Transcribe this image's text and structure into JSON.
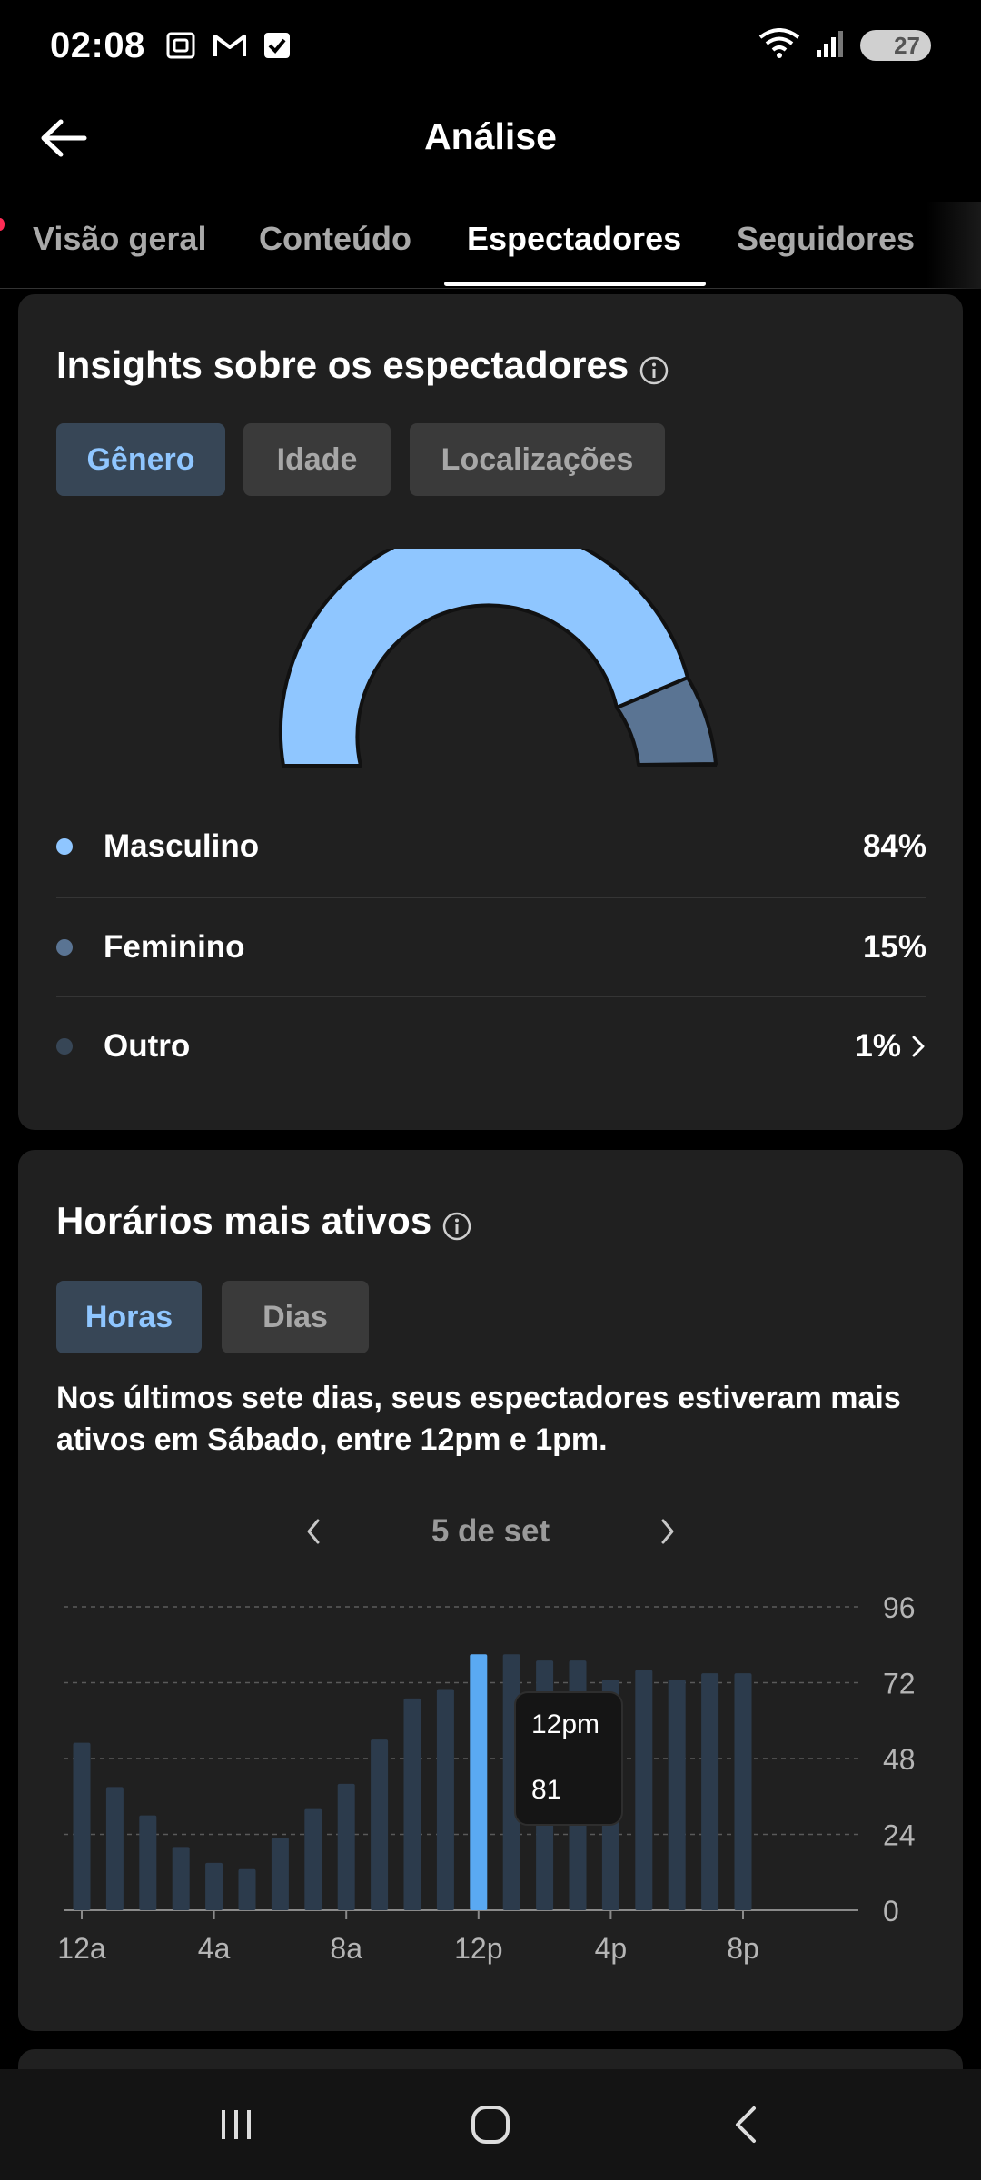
{
  "status_bar": {
    "time": "02:08",
    "battery": "27",
    "icons_left": [
      "screenshot-icon",
      "gmail-icon",
      "check-box-icon"
    ],
    "icons_right": [
      "wifi-icon",
      "signal-icon",
      "battery-icon"
    ]
  },
  "header": {
    "title": "Análise"
  },
  "tabs": [
    {
      "label": "Visão geral"
    },
    {
      "label": "Conteúdo"
    },
    {
      "label": "Espectadores",
      "active": true
    },
    {
      "label": "Seguidores"
    }
  ],
  "viewers": {
    "title": "Insights sobre os espectadores",
    "chips": [
      {
        "label": "Gênero",
        "active": true
      },
      {
        "label": "Idade"
      },
      {
        "label": "Localizações"
      }
    ],
    "legend": [
      {
        "label": "Masculino",
        "value": "84%",
        "color": "#8fc6ff"
      },
      {
        "label": "Feminino",
        "value": "15%",
        "color": "#5a7493"
      },
      {
        "label": "Outro",
        "value": "1%",
        "color": "#374656"
      }
    ]
  },
  "active_times": {
    "title": "Horários mais ativos",
    "chips": [
      {
        "label": "Horas",
        "active": true
      },
      {
        "label": "Dias"
      }
    ],
    "summary": "Nos últimos sete dias, seus espectadores estiveram mais ativos em Sábado, entre 12pm e 1pm.",
    "date": "5 de set",
    "tooltip": {
      "label": "12pm",
      "value": "81"
    }
  },
  "chart_data": {
    "type": "bar",
    "x": [
      "12a",
      "1a",
      "2a",
      "3a",
      "4a",
      "5a",
      "6a",
      "7a",
      "8a",
      "9a",
      "10a",
      "11a",
      "12p",
      "1p",
      "2p",
      "3p",
      "4p",
      "5p",
      "6p",
      "7p",
      "8p"
    ],
    "x_tick_labels": [
      "12a",
      "4a",
      "8a",
      "12p",
      "4p",
      "8p"
    ],
    "values": [
      53,
      39,
      30,
      20,
      15,
      13,
      23,
      32,
      40,
      54,
      67,
      70,
      81,
      81,
      79,
      79,
      73,
      76,
      73,
      75,
      75
    ],
    "highlight_index": 12,
    "ylim": [
      0,
      96
    ],
    "y_ticks": [
      0,
      24,
      48,
      72,
      96
    ],
    "grid": true,
    "bar_color": "#2c3b4c",
    "highlight_color": "#5aa9f2"
  }
}
